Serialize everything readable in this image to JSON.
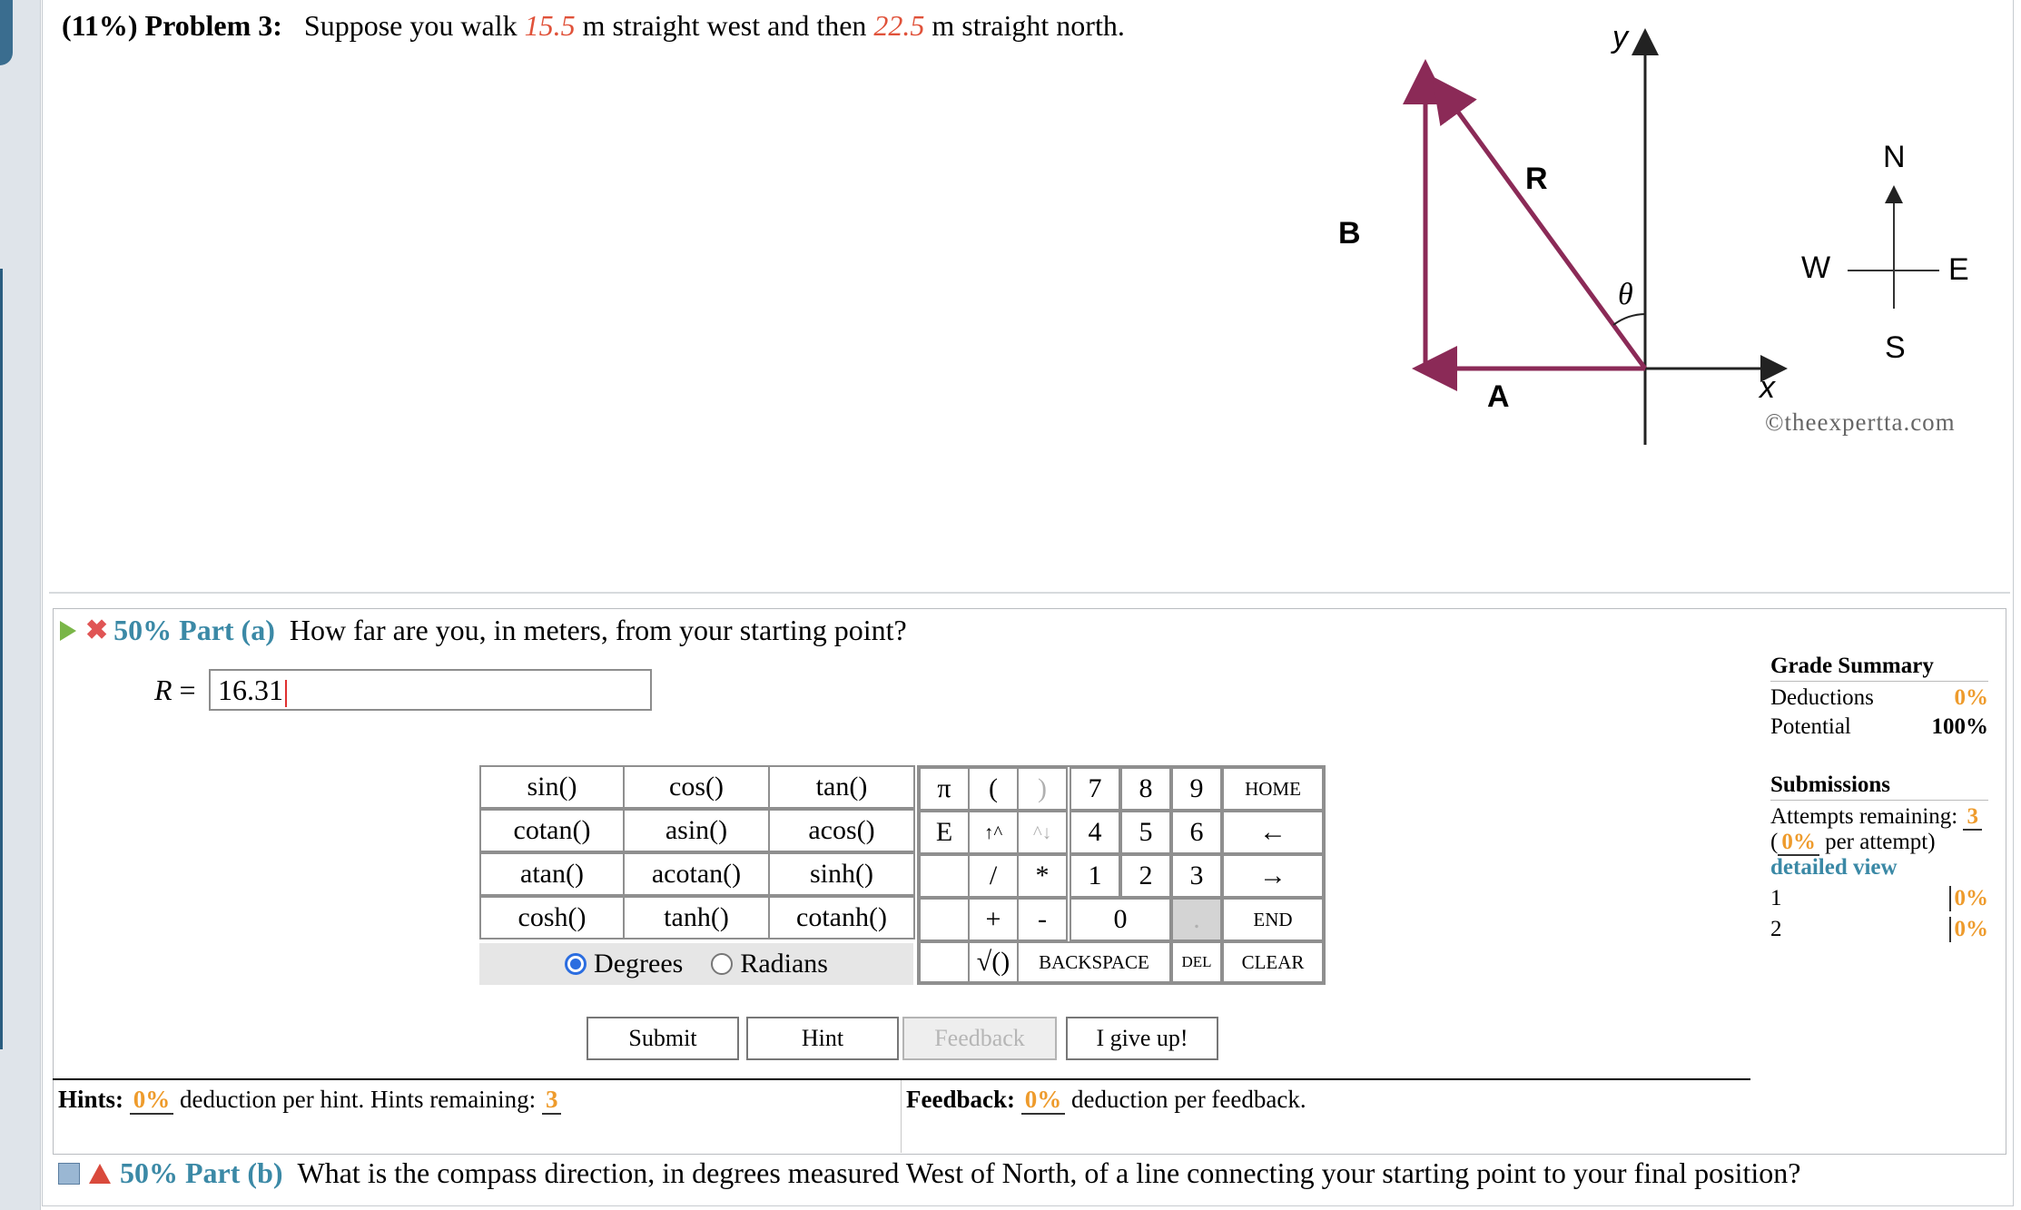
{
  "problem": {
    "weight": "(11%)",
    "label": "Problem 3:",
    "text_before": "Suppose you walk",
    "distance_west": "15.5",
    "text_middle": "m straight west and then",
    "distance_north": "22.5",
    "text_after": "m straight north."
  },
  "figure": {
    "label_b": "B",
    "label_a": "A",
    "label_r": "R",
    "label_theta": "θ",
    "label_x": "x",
    "label_y": "y",
    "compass_n": "N",
    "compass_s": "S",
    "compass_e": "E",
    "compass_w": "W",
    "credit": "©theexpertta.com",
    "vector_color": "#8b2a57"
  },
  "part_a": {
    "weight": "50%",
    "name": "Part (a)",
    "question": "How far are you, in meters, from your starting point?",
    "variable": "R",
    "equals": "=",
    "answer_value": "16.31"
  },
  "keypad": {
    "functions": [
      "sin()",
      "cos()",
      "tan()",
      "cotan()",
      "asin()",
      "acos()",
      "atan()",
      "acotan()",
      "sinh()",
      "cosh()",
      "tanh()",
      "cotanh()"
    ],
    "pi": "π",
    "e": "E",
    "open_paren": "(",
    "close_paren": ")",
    "up": "↑^",
    "down": "^↓",
    "divide": "/",
    "multiply": "*",
    "plus": "+",
    "minus": "-",
    "sqrt": "√()",
    "digits": [
      "7",
      "8",
      "9",
      "4",
      "5",
      "6",
      "1",
      "2",
      "3",
      "0"
    ],
    "dot": ".",
    "home": "HOME",
    "left": "←",
    "right": "→",
    "end": "END",
    "backspace": "BACKSPACE",
    "del": "DEL",
    "clear": "CLEAR",
    "degrees": "Degrees",
    "radians": "Radians"
  },
  "actions": {
    "submit": "Submit",
    "hint": "Hint",
    "feedback": "Feedback",
    "give_up": "I give up!"
  },
  "hints": {
    "label": "Hints:",
    "deduction": "0%",
    "text": "deduction per hint. Hints remaining:",
    "remaining": "3"
  },
  "feedback_info": {
    "label": "Feedback:",
    "deduction": "0%",
    "text": "deduction per feedback."
  },
  "grade_summary": {
    "title": "Grade Summary",
    "deductions_label": "Deductions",
    "deductions_value": "0%",
    "potential_label": "Potential",
    "potential_value": "100%"
  },
  "submissions": {
    "title": "Submissions",
    "attempts_label": "Attempts remaining:",
    "attempts_value": "3",
    "per_attempt_open": "(",
    "per_attempt_value": "0%",
    "per_attempt_text": "per attempt)",
    "detailed_view": "detailed view",
    "rows": [
      {
        "num": "1",
        "value": "0%"
      },
      {
        "num": "2",
        "value": "0%"
      }
    ]
  },
  "part_b": {
    "weight": "50%",
    "name": "Part (b)",
    "question": "What is the compass direction, in degrees measured West of North, of a line connecting your starting point to your final position?"
  },
  "colors": {
    "accent_teal": "#3b89a6",
    "orange": "#ee9b2c",
    "number_red": "#e0523a"
  }
}
